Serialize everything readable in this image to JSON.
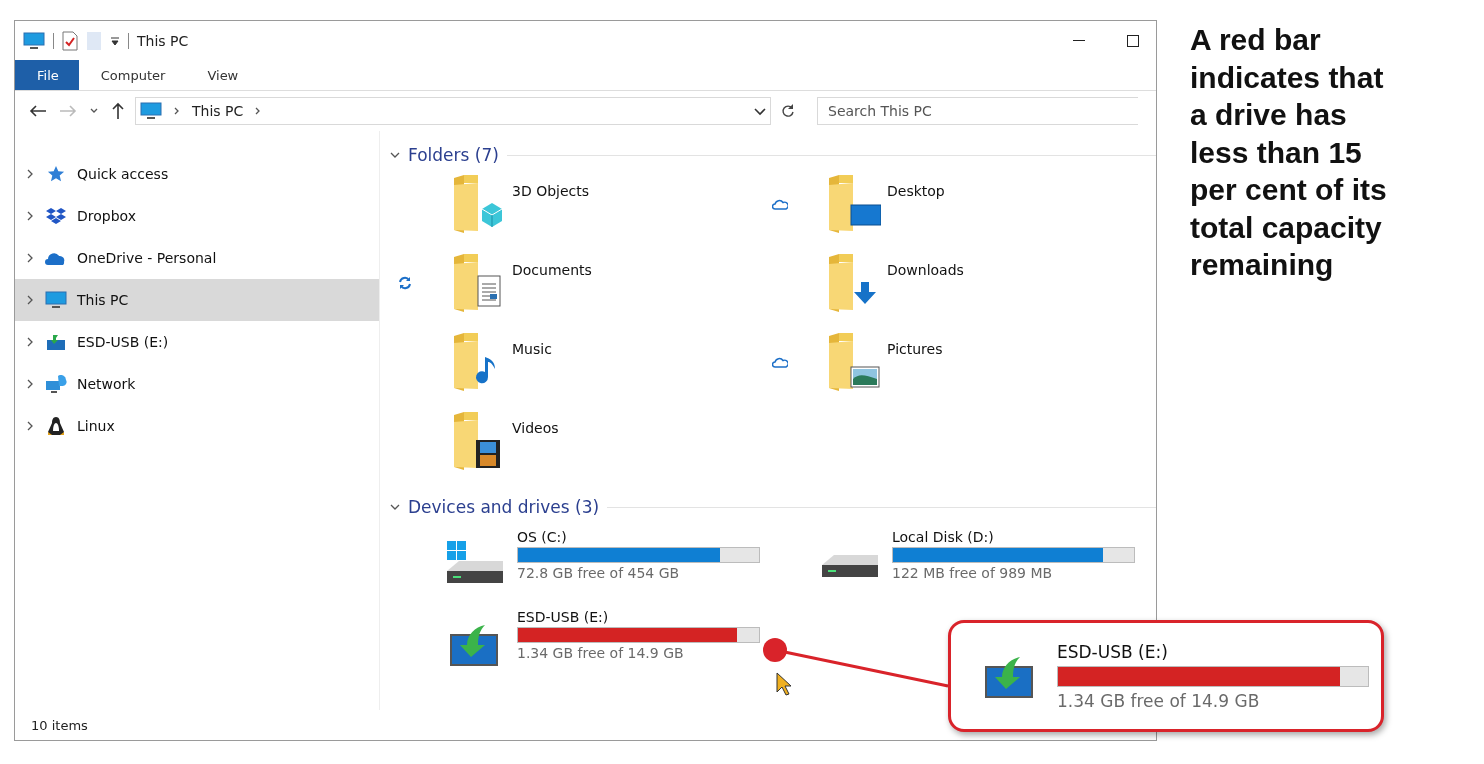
{
  "window": {
    "title": "This PC",
    "ribbon_tabs": [
      {
        "label": "File",
        "selected": true
      },
      {
        "label": "Computer",
        "selected": false
      },
      {
        "label": "View",
        "selected": false
      }
    ]
  },
  "address_bar": {
    "path": "This PC"
  },
  "search": {
    "placeholder": "Search This PC"
  },
  "sidebar": {
    "items": [
      {
        "kind": "star",
        "label": "Quick access",
        "selected": false
      },
      {
        "kind": "dropbox",
        "label": "Dropbox",
        "selected": false
      },
      {
        "kind": "cloud",
        "label": "OneDrive - Personal",
        "selected": false
      },
      {
        "kind": "pc",
        "label": "This PC",
        "selected": true
      },
      {
        "kind": "usb",
        "label": "ESD-USB (E:)",
        "selected": false
      },
      {
        "kind": "network",
        "label": "Network",
        "selected": false
      },
      {
        "kind": "linux",
        "label": "Linux",
        "selected": false
      }
    ]
  },
  "folders": {
    "heading": "Folders (7)",
    "items": [
      {
        "kind": "objects",
        "label": "3D Objects",
        "cloud": false,
        "syncing": false
      },
      {
        "kind": "desktop",
        "label": "Desktop",
        "cloud": true,
        "syncing": false
      },
      {
        "kind": "documents",
        "label": "Documents",
        "cloud": false,
        "syncing": true
      },
      {
        "kind": "downloads",
        "label": "Downloads",
        "cloud": false,
        "syncing": false
      },
      {
        "kind": "music",
        "label": "Music",
        "cloud": false,
        "syncing": false
      },
      {
        "kind": "pictures",
        "label": "Pictures",
        "cloud": true,
        "syncing": false
      },
      {
        "kind": "videos",
        "label": "Videos",
        "cloud": false,
        "syncing": false
      }
    ]
  },
  "drives": {
    "heading": "Devices and drives (3)",
    "items": [
      {
        "kind": "windows",
        "name": "OS (C:)",
        "level": 0.84,
        "color": "#0f7fd3",
        "free": "72.8 GB free of 454 GB"
      },
      {
        "kind": "disk",
        "name": "Local Disk (D:)",
        "level": 0.87,
        "color": "#0f7fd3",
        "free": "122 MB free of 989 MB"
      },
      {
        "kind": "usb",
        "name": "ESD-USB (E:)",
        "level": 0.91,
        "color": "#d42323",
        "free": "1.34 GB free of 14.9 GB"
      }
    ]
  },
  "status_bar": {
    "count": "10 items"
  },
  "callout": {
    "name": "ESD-USB (E:)",
    "level": 0.91,
    "color": "#d42323",
    "free": "1.34 GB free of 14.9 GB"
  },
  "caption": "A red bar indicates that a drive has less than 15 per cent of its total capacity remaining"
}
